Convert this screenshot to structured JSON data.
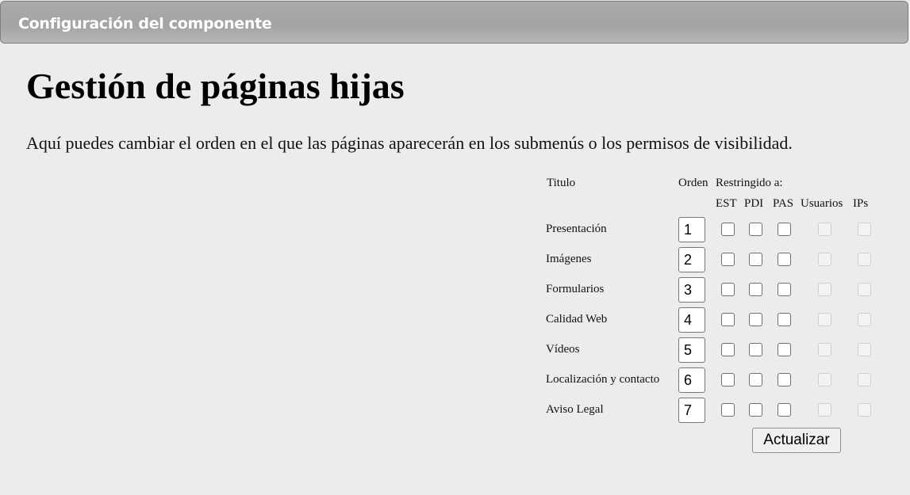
{
  "header": {
    "title": "Configuración del componente"
  },
  "page": {
    "title": "Gestión de páginas hijas",
    "description": "Aquí puedes cambiar el orden en el que las páginas aparecerán en los submenús o los permisos de visibilidad."
  },
  "table": {
    "col_title": "Titulo",
    "col_order": "Orden",
    "col_restricted": "Restringido a:",
    "sub_est": "EST",
    "sub_pdi": "PDI",
    "sub_pas": "PAS",
    "sub_users": "Usuarios",
    "sub_ips": "IPs",
    "rows": [
      {
        "title": "Presentación",
        "order": "1"
      },
      {
        "title": "Imágenes",
        "order": "2"
      },
      {
        "title": "Formularios",
        "order": "3"
      },
      {
        "title": "Calidad Web",
        "order": "4"
      },
      {
        "title": "Vídeos",
        "order": "5"
      },
      {
        "title": "Localización y contacto",
        "order": "6"
      },
      {
        "title": "Aviso Legal",
        "order": "7"
      }
    ]
  },
  "actions": {
    "update_label": "Actualizar"
  }
}
